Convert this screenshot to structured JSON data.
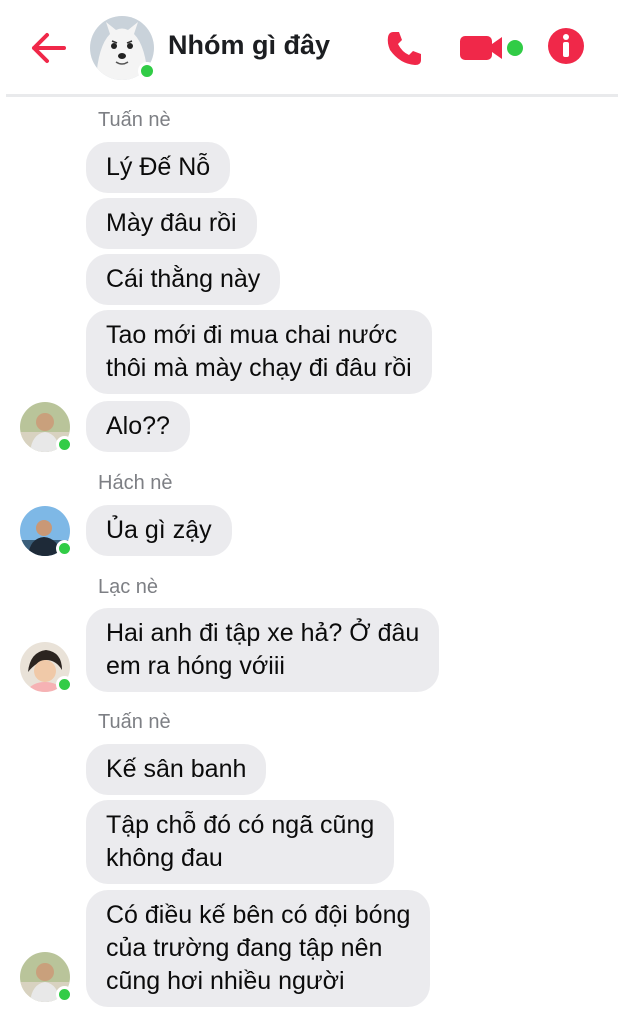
{
  "header": {
    "title": "Nhóm gì đây",
    "back_icon": "arrow-left-icon",
    "call_icon": "phone-icon",
    "video_icon": "video-camera-icon",
    "info_icon": "info-icon",
    "accent_color": "#f02849"
  },
  "messages": {
    "s1": {
      "sender": "Tuấn nè"
    },
    "m1": "Lý Đế Nỗ",
    "m2": "Mày đâu rồi",
    "m3": "Cái thằng này",
    "m4_line1": "Tao mới đi mua chai nước",
    "m4_line2": "thôi mà mày chạy đi đâu rồi",
    "m5": "Alo??",
    "s2": {
      "sender": "Hách nè"
    },
    "m6": "Ủa gì zậy",
    "s3": {
      "sender": "Lạc nè"
    },
    "m7_line1": "Hai anh đi tập xe hả? Ở đâu",
    "m7_line2": "em ra hóng vớiii",
    "s4": {
      "sender": "Tuấn nè"
    },
    "m8": "Kế sân banh",
    "m9_line1": "Tập chỗ đó có ngã cũng",
    "m9_line2": "không đau",
    "m10_line1": "Có điều kế bên có đội bóng",
    "m10_line2": "của trường đang tập nên",
    "m10_line3": "cũng hơi nhiều người"
  },
  "colors": {
    "bubble": "#ebebee",
    "online": "#31cc46",
    "sender_name": "#7d7f84"
  }
}
